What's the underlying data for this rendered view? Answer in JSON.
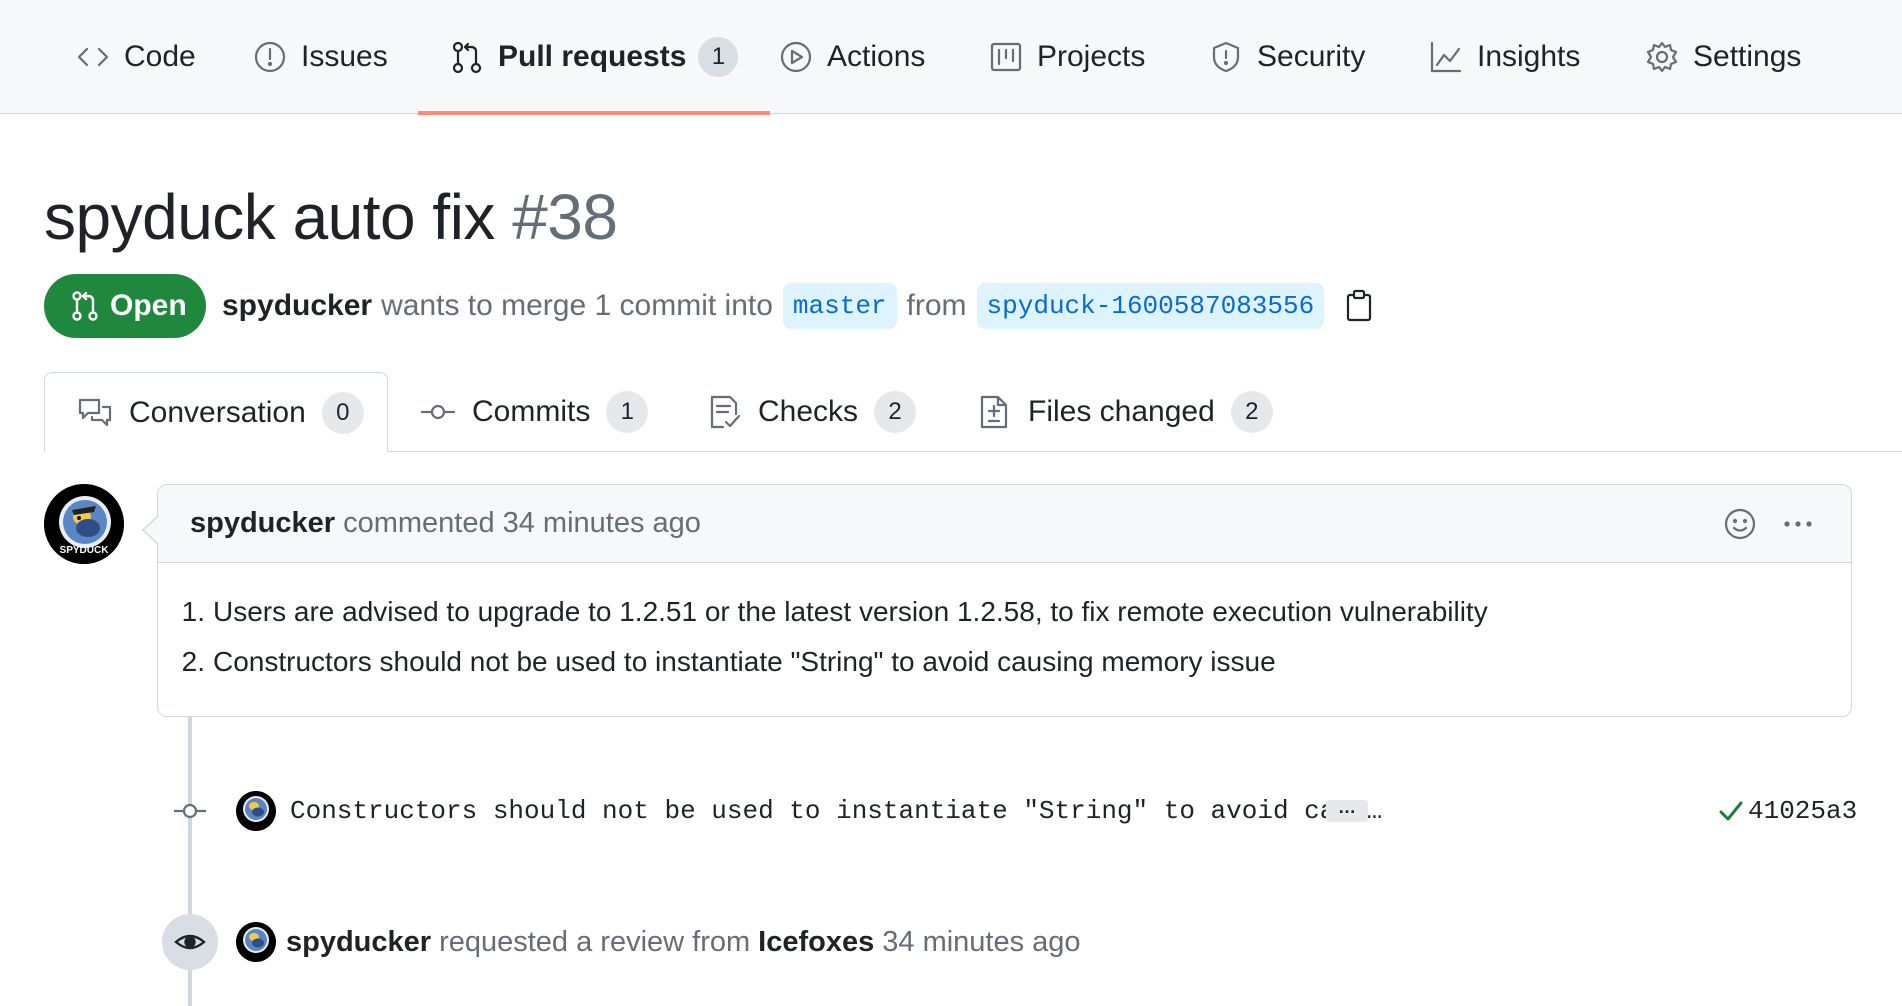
{
  "repo_nav": {
    "tabs": [
      {
        "label": "Code",
        "icon": "code-icon"
      },
      {
        "label": "Issues",
        "icon": "issue-opened-icon"
      },
      {
        "label": "Pull requests",
        "icon": "git-pull-request-icon",
        "counter": "1",
        "selected": true
      },
      {
        "label": "Actions",
        "icon": "play-icon"
      },
      {
        "label": "Projects",
        "icon": "project-icon"
      },
      {
        "label": "Security",
        "icon": "shield-icon"
      },
      {
        "label": "Insights",
        "icon": "graph-icon"
      },
      {
        "label": "Settings",
        "icon": "gear-icon"
      }
    ]
  },
  "pr": {
    "title": "spyduck auto fix",
    "number": "#38",
    "state": "Open",
    "author": "spyducker",
    "merge_text": "wants to merge 1 commit into",
    "base_branch": "master",
    "from_text": "from",
    "head_branch": "spyduck-1600587083556"
  },
  "pr_tabs": [
    {
      "label": "Conversation",
      "counter": "0",
      "icon": "comment-discussion-icon",
      "active": true
    },
    {
      "label": "Commits",
      "counter": "1",
      "icon": "git-commit-icon"
    },
    {
      "label": "Checks",
      "counter": "2",
      "icon": "checklist-icon"
    },
    {
      "label": "Files changed",
      "counter": "2",
      "icon": "file-diff-icon"
    }
  ],
  "comment": {
    "author": "spyducker",
    "action": "commented",
    "time": "34 minutes ago",
    "items": [
      {
        "num": "1.",
        "text": "Users are advised to upgrade to 1.2.51 or the latest version 1.2.58, to fix remote execution vulnerability"
      },
      {
        "num": "2.",
        "text": "Constructors should not be used to instantiate \"String\" to avoid causing memory issue"
      }
    ]
  },
  "commit": {
    "message": "Constructors should not be used to instantiate \"String\" to avoid caus…",
    "ellipsis": "…",
    "sha": "41025a3",
    "status_color": "#1a7f37"
  },
  "review_event": {
    "actor": "spyducker",
    "action": "requested a review from",
    "reviewer": "Icefoxes",
    "time": "34 minutes ago"
  },
  "avatar_text": "SPYDUCK",
  "colors": {
    "open_green": "#1f883d",
    "link_blue": "#0969da",
    "branch_bg": "#ddf4ff",
    "selected_underline": "#fd8c73"
  }
}
